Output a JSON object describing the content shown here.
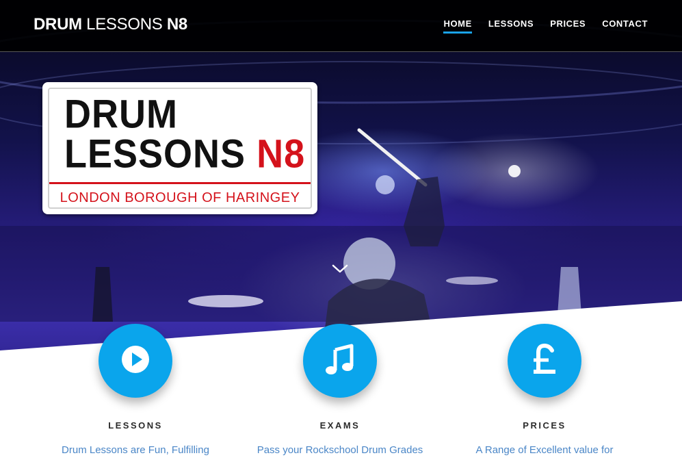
{
  "header": {
    "brand_bold": "DRUM",
    "brand_light": "LESSONS",
    "brand_suffix": "N8",
    "nav": [
      {
        "label": "HOME",
        "active": true
      },
      {
        "label": "LESSONS",
        "active": false
      },
      {
        "label": "PRICES",
        "active": false
      },
      {
        "label": "CONTACT",
        "active": false
      }
    ]
  },
  "hero": {
    "sign": {
      "line1": "DRUM",
      "line2_black": "LESSONS",
      "line2_red": "N8",
      "subtitle": "LONDON BOROUGH OF HARINGEY"
    },
    "scroll_icon": "chevron-down-icon"
  },
  "features": [
    {
      "icon": "play-icon",
      "title": "LESSONS",
      "description": "Drum Lessons are Fun, Fulfilling"
    },
    {
      "icon": "music-note-icon",
      "title": "EXAMS",
      "description": "Pass your Rockschool Drum Grades"
    },
    {
      "icon": "pound-icon",
      "title": "PRICES",
      "description": "A Range of Excellent value for"
    }
  ],
  "colors": {
    "accent": "#0aa5ec",
    "nav_underline": "#1aa3e8",
    "sign_red": "#d4121b",
    "feature_text": "#4a86c7"
  }
}
